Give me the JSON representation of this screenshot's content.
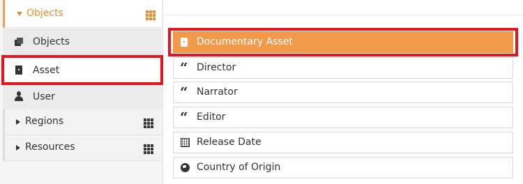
{
  "sidebar": {
    "header": {
      "label": "Objects"
    },
    "items": [
      {
        "label": "Objects",
        "icon": "cube-icon"
      },
      {
        "label": "Asset",
        "icon": "document-icon",
        "selected": true
      },
      {
        "label": "User",
        "icon": "user-icon"
      }
    ],
    "groups": [
      {
        "label": "Regions"
      },
      {
        "label": "Resources"
      }
    ]
  },
  "main": {
    "items": [
      {
        "label": "Documentary Asset",
        "icon": "document-icon",
        "selected": true
      },
      {
        "label": "Director",
        "icon": "quote-icon"
      },
      {
        "label": "Narrator",
        "icon": "quote-icon"
      },
      {
        "label": "Editor",
        "icon": "quote-icon"
      },
      {
        "label": "Release Date",
        "icon": "calendar-icon"
      },
      {
        "label": "Country of Origin",
        "icon": "globe-icon"
      }
    ]
  },
  "colors": {
    "accent": "#ef8a2f",
    "selected_bg": "#f29a4a",
    "highlight": "#e8141c"
  }
}
